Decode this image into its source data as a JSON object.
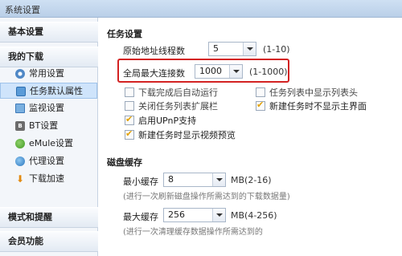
{
  "window": {
    "title": "系统设置"
  },
  "sidebar": {
    "sections": [
      {
        "label": "基本设置"
      },
      {
        "label": "我的下载"
      },
      {
        "label": "模式和提醒"
      },
      {
        "label": "会员功能"
      }
    ],
    "items": [
      {
        "label": "常用设置",
        "icon": "gear-icon"
      },
      {
        "label": "任务默认属性",
        "icon": "task-icon"
      },
      {
        "label": "监视设置",
        "icon": "monitor-icon"
      },
      {
        "label": "BT设置",
        "icon": "bt-icon"
      },
      {
        "label": "eMule设置",
        "icon": "emule-icon"
      },
      {
        "label": "代理设置",
        "icon": "proxy-icon"
      },
      {
        "label": "下载加速",
        "icon": "speed-icon"
      }
    ]
  },
  "task_settings": {
    "title": "任务设置",
    "original_threads": {
      "label": "原始地址线程数",
      "value": "5",
      "range": "(1-10)"
    },
    "global_max_connections": {
      "label": "全局最大连接数",
      "value": "1000",
      "range": "(1-1000)"
    },
    "checkboxes": {
      "auto_run": "下载完成后自动运行",
      "show_header": "任务列表中显示列表头",
      "close_expand": "关闭任务列表扩展栏",
      "no_main_ui": "新建任务时不显示主界面",
      "upnp": "启用UPnP支持",
      "video_preview": "新建任务时显示视频预览"
    }
  },
  "disk_cache": {
    "title": "磁盘缓存",
    "min_cache": {
      "label": "最小缓存",
      "value": "8",
      "range": "MB(2-16)",
      "note": "(进行一次刷新磁盘操作所需达到的下载数据量)"
    },
    "max_cache": {
      "label": "最大缓存",
      "value": "256",
      "range": "MB(4-256)",
      "note": "(进行一次清理缓存数据操作所需达到的"
    }
  },
  "colors": {
    "highlight": "#d32222",
    "selected": "#cfe4fb"
  }
}
